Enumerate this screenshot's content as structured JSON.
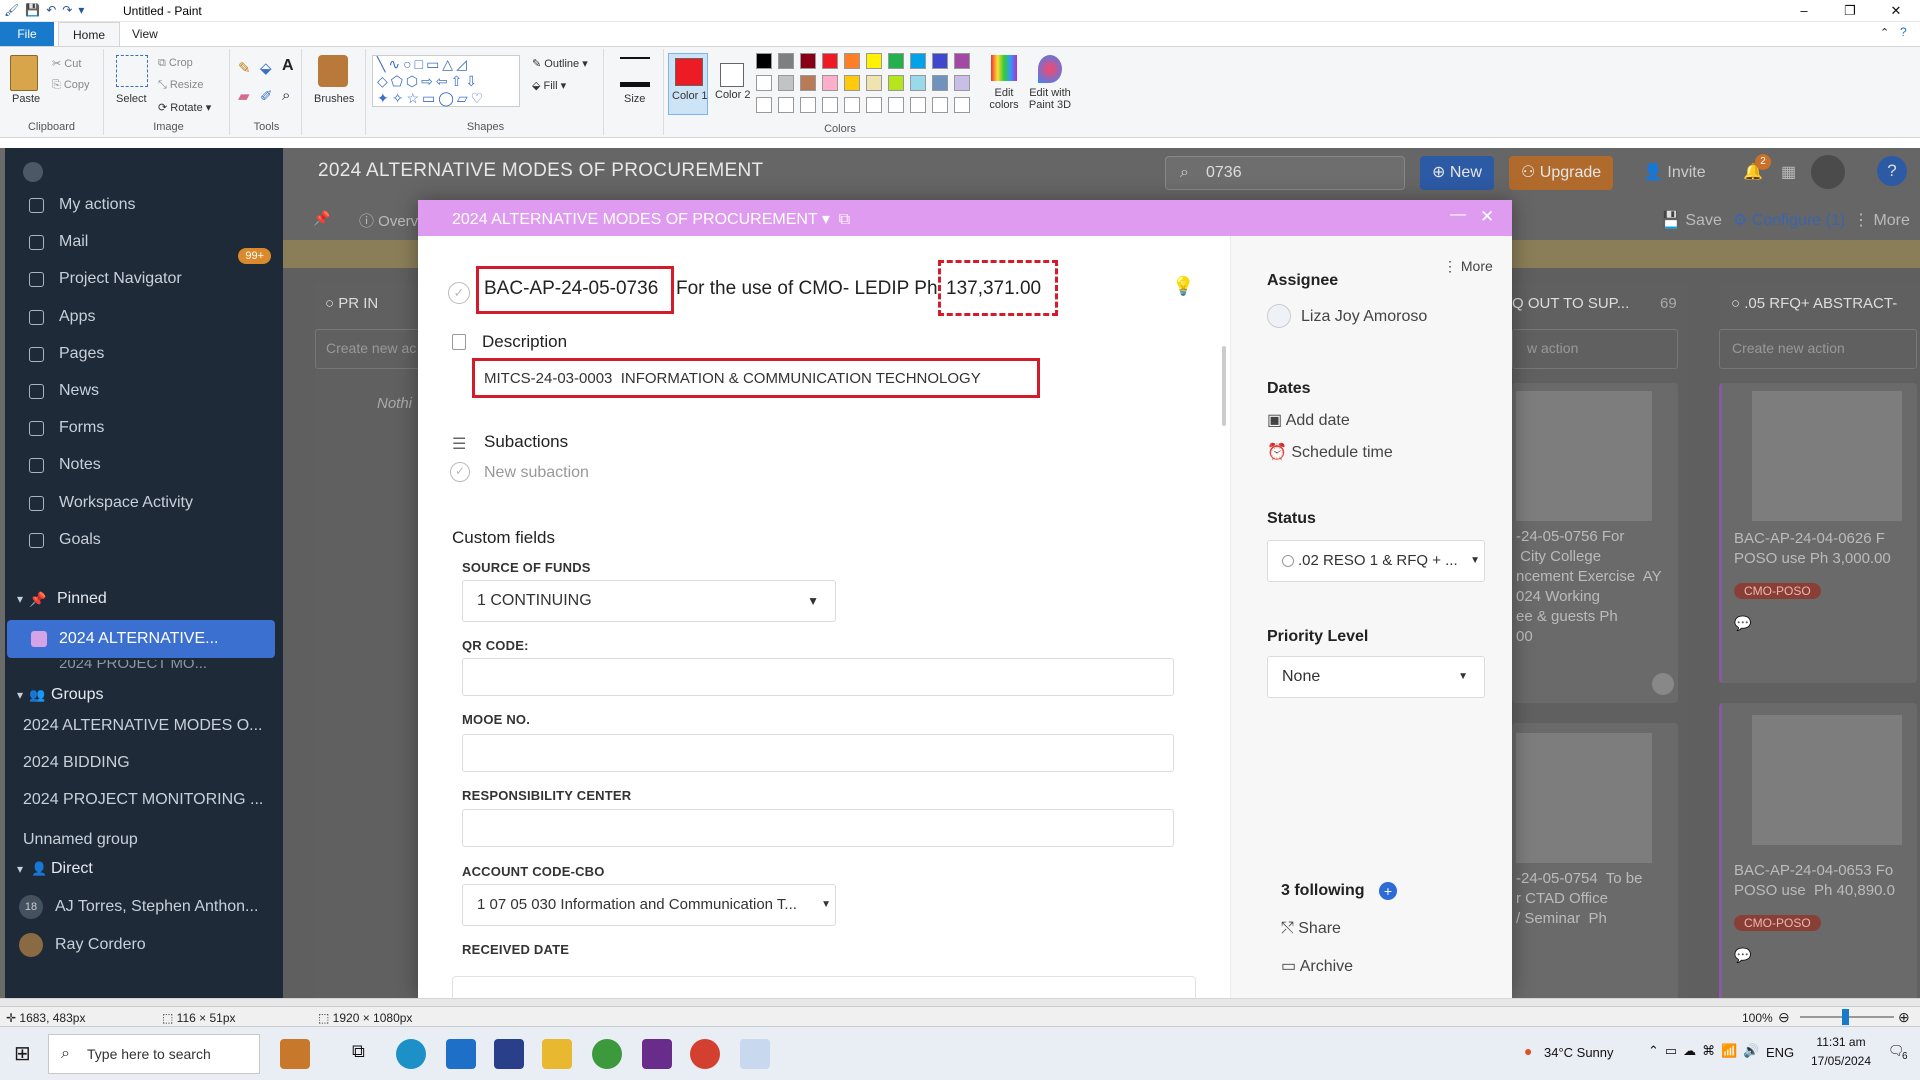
{
  "window": {
    "title": "Untitled - Paint",
    "minimize": "–",
    "maximize": "❐",
    "close": "✕"
  },
  "ribbon_tabs": [
    "File",
    "Home",
    "View"
  ],
  "ribbon": {
    "clipboard": {
      "paste": "Paste",
      "cut": "Cut",
      "copy": "Copy",
      "label": "Clipboard"
    },
    "image": {
      "select": "Select",
      "crop": "Crop",
      "resize": "Resize",
      "rotate": "Rotate",
      "label": "Image"
    },
    "tools": {
      "label": "Tools"
    },
    "brushes": "Brushes",
    "shapes": {
      "outline": "Outline",
      "fill": "Fill",
      "label": "Shapes"
    },
    "size": "Size",
    "color1": "Color 1",
    "color2": "Color 2",
    "colors_label": "Colors",
    "edit_colors": "Edit colors",
    "paint3d": "Edit with Paint 3D",
    "palette_row1": [
      "#000000",
      "#7f7f7f",
      "#880015",
      "#ed1c24",
      "#ff7f27",
      "#fff200",
      "#22b14c",
      "#00a2e8",
      "#3f48cc",
      "#a349a4"
    ],
    "palette_row2": [
      "#ffffff",
      "#c3c3c3",
      "#b97a57",
      "#ffaec9",
      "#ffc90e",
      "#efe4b0",
      "#b5e61d",
      "#99d9ea",
      "#7092be",
      "#c8bfe7"
    ]
  },
  "sidebar": {
    "items": [
      {
        "label": "My actions"
      },
      {
        "label": "Mail",
        "badge": "99+"
      },
      {
        "label": "Project Navigator"
      },
      {
        "label": "Apps"
      },
      {
        "label": "Pages"
      },
      {
        "label": "News"
      },
      {
        "label": "Forms"
      },
      {
        "label": "Notes"
      },
      {
        "label": "Workspace Activity"
      },
      {
        "label": "Goals"
      }
    ],
    "pinned_label": "Pinned",
    "pinned_active": "2024 ALTERNATIVE...",
    "pinned_next": "2024 PROJECT MO...",
    "groups_label": "Groups",
    "groups": [
      "2024 ALTERNATIVE MODES O...",
      "2024 BIDDING",
      "2024 PROJECT MONITORING ...",
      "Unnamed group"
    ],
    "direct_label": "Direct",
    "direct": [
      {
        "avatar": "18",
        "name": "AJ Torres, Stephen Anthon..."
      },
      {
        "avatar": "",
        "name": "Ray Cordero"
      }
    ]
  },
  "app_header": {
    "title": "2024 ALTERNATIVE MODES OF PROCUREMENT",
    "search": "0736",
    "new": "New",
    "upgrade": "Upgrade",
    "invite": "Invite",
    "notif_count": "2"
  },
  "toolbar": {
    "overview": "Overv",
    "save": "Save",
    "configure": "Configure (1)",
    "more": "More"
  },
  "board": {
    "col1": {
      "title": "PR IN",
      "create": "Create new ac",
      "empty": "Nothi"
    },
    "col2": {
      "title": "Q OUT TO SUP...",
      "count": "69",
      "create": "w action",
      "card1": [
        "-24-05-0756 For",
        " City College",
        "ncement Exercise  AY",
        "024 Working",
        "ee & guests Ph",
        "00"
      ],
      "card2": [
        "-24-05-0754  To be",
        "r CTAD Office",
        "/ Seminar  Ph"
      ]
    },
    "col3": {
      "title": ".05 RFQ+ ABSTRACT-",
      "create": "Create new action",
      "card1": [
        "BAC-AP-24-04-0626 F",
        "POSO use Ph 3,000.00"
      ],
      "tag1": "CMO-POSO",
      "card2": [
        "BAC-AP-24-04-0653 Fo",
        "POSO use  Ph 40,890.0"
      ],
      "tag2": "CMO-POSO"
    }
  },
  "modal": {
    "header": "2024 ALTERNATIVE MODES OF PROCUREMENT",
    "task_id": "BAC-AP-24-05-0736",
    "task_text": "For the use of CMO- LEDIP  Ph",
    "amount": "137,371.00",
    "description_label": "Description",
    "description": "MITCS-24-03-0003  INFORMATION & COMMUNICATION TECHNOLOGY",
    "subactions_label": "Subactions",
    "new_subaction": "New subaction",
    "custom_fields_label": "Custom fields",
    "fields": {
      "source_label": "SOURCE OF FUNDS",
      "source_value": "1 CONTINUING",
      "qr_label": "QR CODE:",
      "mooe_label": "MOOE NO.",
      "resp_label": "RESPONSIBILITY CENTER",
      "account_label": "ACCOUNT CODE-CBO",
      "account_value": "1 07 05 030 Information and Communication T...",
      "received_label": "RECEIVED DATE"
    },
    "right": {
      "more": "More",
      "assignee_label": "Assignee",
      "assignee": "Liza Joy Amoroso",
      "dates_label": "Dates",
      "add_date": "Add date",
      "schedule": "Schedule time",
      "status_label": "Status",
      "status": ".02 RESO 1 & RFQ + ...",
      "priority_label": "Priority Level",
      "priority": "None",
      "following": "3 following",
      "share": "Share",
      "archive": "Archive"
    }
  },
  "statusbar": {
    "cursor": "1683, 483px",
    "selection": "116 × 51px",
    "canvas": "1920 × 1080px",
    "zoom": "100%"
  },
  "taskbar": {
    "search": "Type here to search",
    "weather": "34°C  Sunny",
    "lang": "ENG",
    "time": "11:31 am",
    "date": "17/05/2024",
    "notif": "6"
  }
}
